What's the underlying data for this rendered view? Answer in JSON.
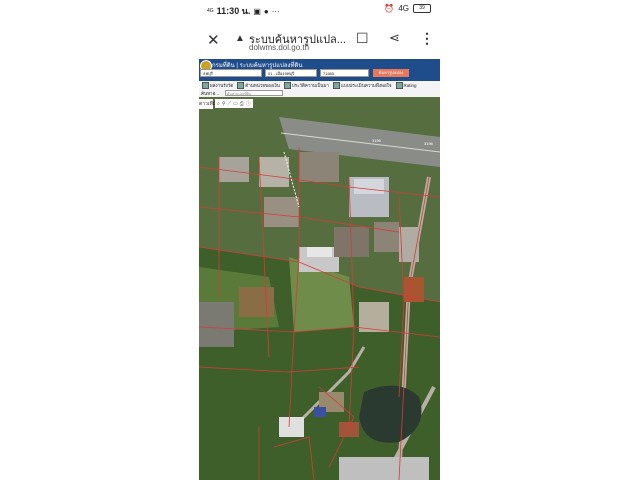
{
  "statusbar": {
    "network": "4G",
    "time": "11:30 น.",
    "icons_left": [
      "sim-icon",
      "chat-icon",
      "more-dots"
    ],
    "more": "···",
    "lte": "4G",
    "battery": "39"
  },
  "browser": {
    "title": "ระบบค้นหารูปแปล...",
    "url": "dolwms.dol.go.th",
    "close": "✕",
    "warning": "▲",
    "bookmark": "☐",
    "share": "⋖",
    "more": "⋮"
  },
  "app": {
    "title": "กรมที่ดิน | ระบบค้นหารูปแปลงที่ดิน",
    "province_select": "ลพบุรี",
    "amphoe_select": "01 - เมืองลพบุรี",
    "parcel_input": "71665",
    "search_button": "ค้นหารูปแปลง",
    "layers": [
      {
        "label": "ผลงานรังวัด"
      },
      {
        "label": "ด้านหน่วยของเงิน"
      },
      {
        "label": "ประวัติความเป็นมา"
      },
      {
        "label": "แบบประเมินความพึงพอใจ"
      },
      {
        "label": "Rating"
      }
    ],
    "address_label": "ค้นหาอ...",
    "address_placeholder": "ค้นหาแปลงที่ดิน",
    "map_tool_label": "ดาวเทียม",
    "toolbar_icons": [
      "zoom-icon",
      "pin-icon",
      "measure-icon",
      "area-icon",
      "print-icon",
      "info-icon"
    ]
  },
  "map": {
    "road_labels": [
      "3196",
      "3196"
    ]
  },
  "colors": {
    "header_blue": "#1f4d8c",
    "search_orange": "#e8785c",
    "parcel_red": "#d63b3b"
  }
}
